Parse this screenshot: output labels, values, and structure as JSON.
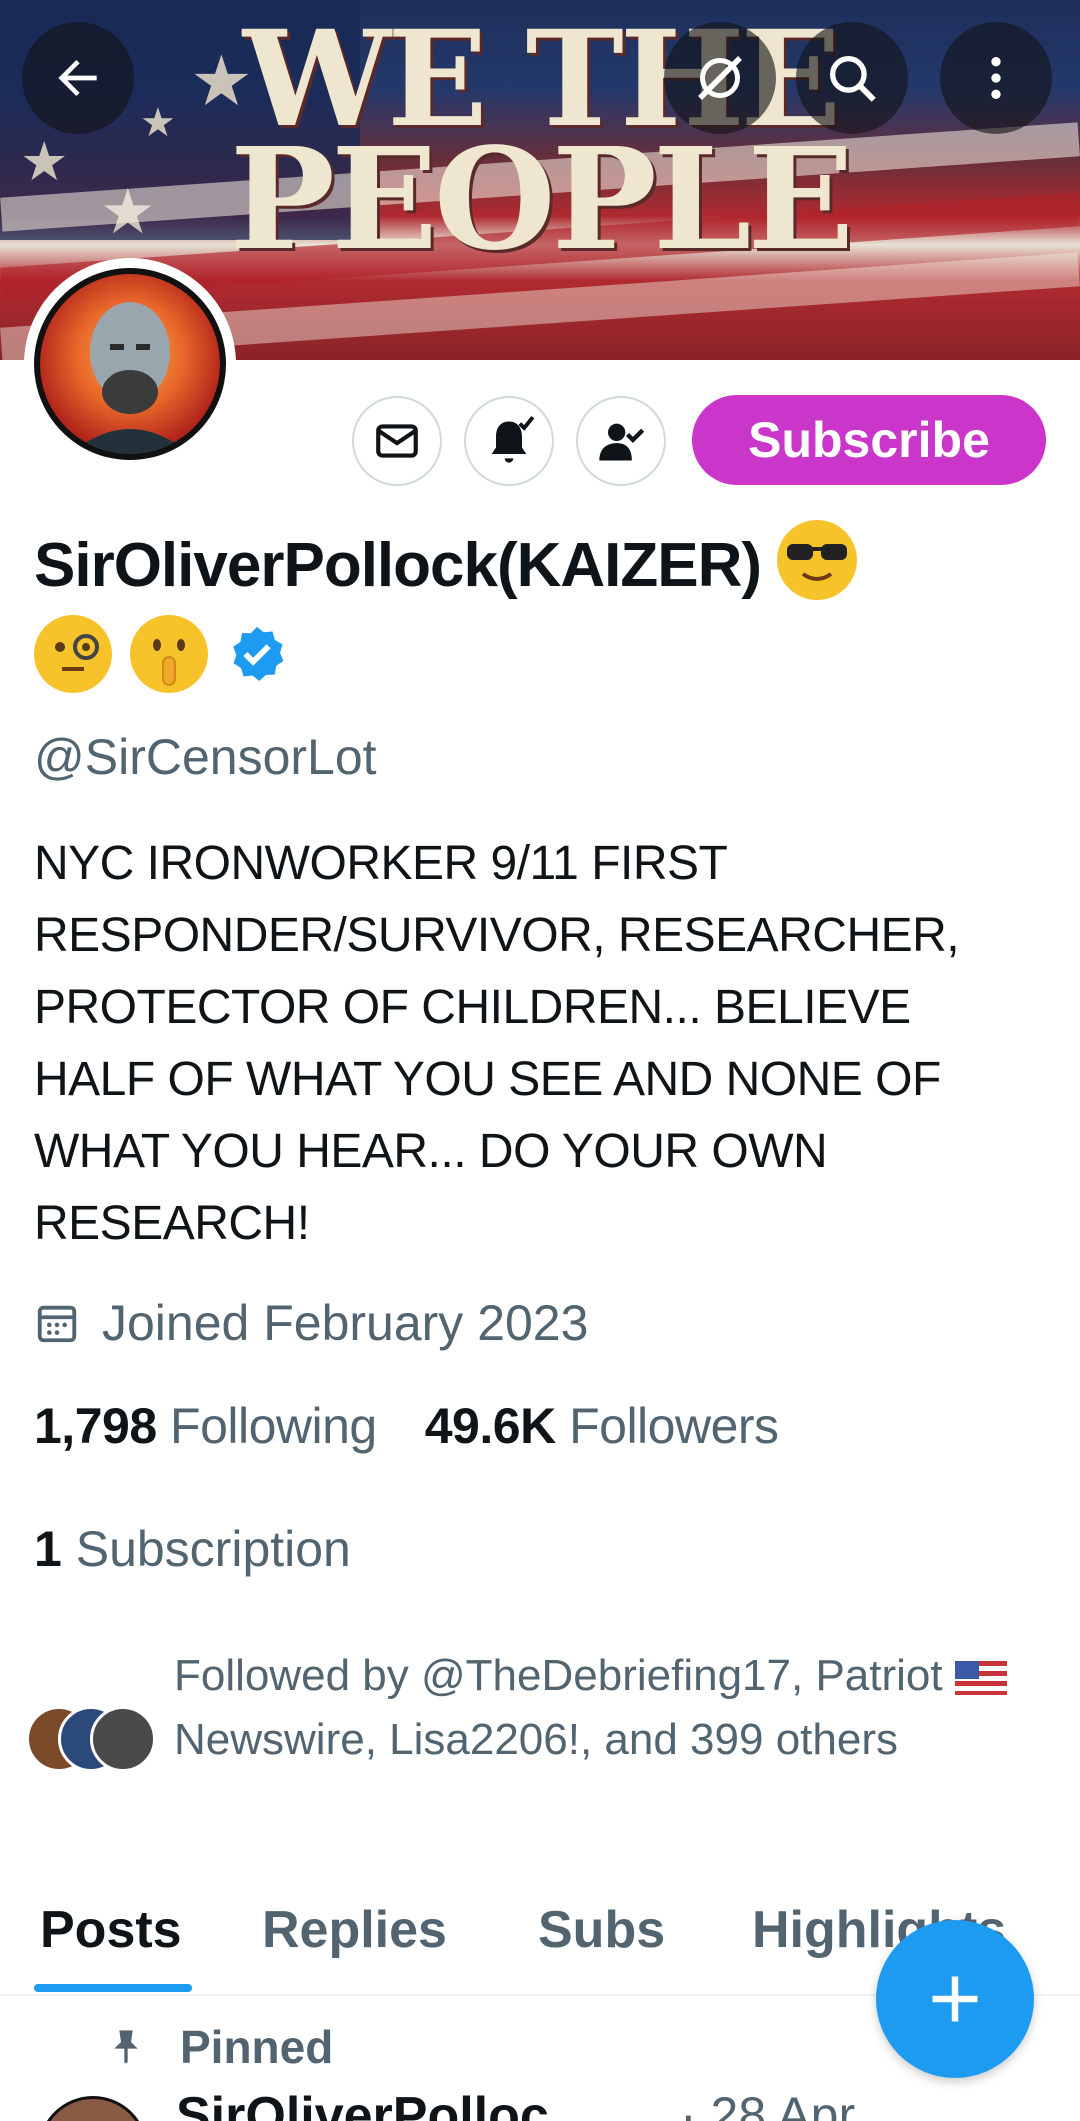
{
  "profile": {
    "banner_title_line1": "WE THE",
    "banner_title_line2": "PEOPLE",
    "display_name": "SirOliverPollock(KAIZER)",
    "handle": "@SirCensorLot",
    "bio": "NYC IRONWORKER 9/11 FIRST RESPONDER/SURVIVOR, RESEARCHER, PROTECTOR OF CHILDREN... BELIEVE HALF OF WHAT YOU SEE AND NONE OF WHAT YOU HEAR... DO YOUR OWN RESEARCH!",
    "joined": "Joined February 2023",
    "following_count": "1,798",
    "following_label": "Following",
    "followers_count": "49.6K",
    "followers_label": "Followers",
    "subscription_count": "1",
    "subscription_label": "Subscription",
    "followed_by_part1": "Followed by @TheDebriefing17, Patriot ",
    "followed_by_part2": "Newswire, Lisa2206!, and 399 others"
  },
  "actions": {
    "subscribe_label": "Subscribe"
  },
  "tabs": [
    {
      "label": "Posts"
    },
    {
      "label": "Replies"
    },
    {
      "label": "Subs"
    },
    {
      "label": "Highlights"
    }
  ],
  "post": {
    "pinned_label": "Pinned",
    "author": "SirOliverPolloc",
    "date": "· 28 Apr"
  },
  "colors": {
    "subscribe_bg": "#c936c9",
    "accent_blue": "#1d9bf0",
    "muted_text": "#536471",
    "primary_text": "#0f1419"
  },
  "icons": [
    "back-arrow-icon",
    "grok-icon",
    "search-icon",
    "more-options-icon",
    "mail-icon",
    "notification-bell-icon",
    "following-person-icon",
    "verified-badge-icon",
    "calendar-icon",
    "pin-icon",
    "compose-plus-icon"
  ]
}
